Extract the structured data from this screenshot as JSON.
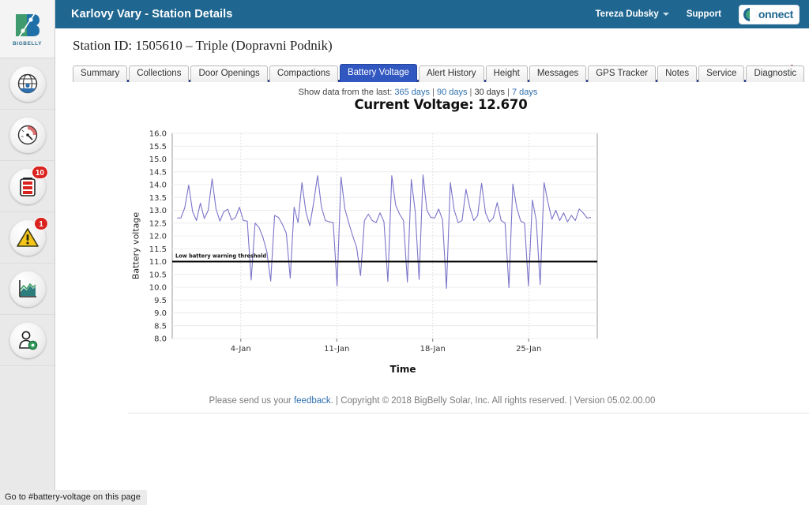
{
  "window": {
    "status_bar_text": "Go to #battery-voltage on this page"
  },
  "rail": {
    "logo": {
      "name": "bigbelly-logo",
      "wordmark": "BIGBELLY"
    },
    "items": [
      {
        "name": "globe-icon",
        "badge": null
      },
      {
        "name": "gauge-icon",
        "badge": null
      },
      {
        "name": "battery-icon",
        "badge": "10"
      },
      {
        "name": "alert-warning-icon",
        "badge": "1"
      },
      {
        "name": "chart-report-icon",
        "badge": null
      },
      {
        "name": "user-settings-icon",
        "badge": null
      }
    ]
  },
  "header": {
    "title": "Karlovy Vary - Station Details",
    "user": "Tereza Dubsky",
    "support": "Support",
    "brand": "onnect",
    "brand_full": "Connect",
    "bg_color": "#1f6690"
  },
  "page": {
    "station_id_label": "Station ID:",
    "station_id_value": "1505610 – Triple (Dopravni Podnik)",
    "station_line": "Station ID: 1505610 – Triple (Dopravni Podnik)",
    "edit_icon": "pencil-icon"
  },
  "tabs": [
    {
      "label": "Summary",
      "active": false
    },
    {
      "label": "Collections",
      "active": false
    },
    {
      "label": "Door Openings",
      "active": false
    },
    {
      "label": "Compactions",
      "active": false
    },
    {
      "label": "Battery Voltage",
      "active": true
    },
    {
      "label": "Alert History",
      "active": false
    },
    {
      "label": "Height",
      "active": false
    },
    {
      "label": "Messages",
      "active": false
    },
    {
      "label": "GPS Tracker",
      "active": false
    },
    {
      "label": "Notes",
      "active": false
    },
    {
      "label": "Service",
      "active": false
    },
    {
      "label": "Diagnostic",
      "active": false
    }
  ],
  "range_selector": {
    "prefix": "Show data from the last:",
    "options": [
      {
        "label": "365 days",
        "selected": false
      },
      {
        "label": "90 days",
        "selected": false
      },
      {
        "label": "30 days",
        "selected": true
      },
      {
        "label": "7 days",
        "selected": false
      }
    ],
    "separator": "|"
  },
  "footer": {
    "prefix": "Please send us your ",
    "link": "feedback",
    "suffix": ". | Copyright © 2018 BigBelly Solar, Inc. All rights reserved. | Version 05.02.00.00"
  },
  "chart_data": {
    "type": "line",
    "title": "Current Voltage: 12.670",
    "current_voltage": "12.670",
    "xlabel": "Time",
    "ylabel": "Battery voltage",
    "ylim": [
      8.0,
      16.0
    ],
    "ytick_step": 0.5,
    "yticks": [
      "16.0",
      "15.5",
      "15.0",
      "14.5",
      "14.0",
      "13.5",
      "13.0",
      "12.5",
      "12.0",
      "11.5",
      "11.0",
      "10.5",
      "10.0",
      "9.5",
      "9.0",
      "8.5",
      "8.0"
    ],
    "xticks": [
      "4-Jan",
      "11-Jan",
      "18-Jan",
      "25-Jan"
    ],
    "xtick_positions": [
      0.1613,
      0.3871,
      0.6129,
      0.8387
    ],
    "grid": true,
    "legend": null,
    "line_color": "#7b74c9",
    "threshold": {
      "label": "Low battery warning threshold",
      "value": 11.0,
      "color": "#000000"
    },
    "series": [
      {
        "name": "Battery voltage",
        "values": [
          12.7,
          12.7,
          13.1,
          13.98,
          12.95,
          12.6,
          13.28,
          12.68,
          13.0,
          14.22,
          13.05,
          12.58,
          12.95,
          13.04,
          12.62,
          12.72,
          13.12,
          12.6,
          12.58,
          10.28,
          12.5,
          12.33,
          11.95,
          11.4,
          10.24,
          12.8,
          12.72,
          12.45,
          12.1,
          10.35,
          13.12,
          12.52,
          14.08,
          12.95,
          12.4,
          13.3,
          14.35,
          13.12,
          12.6,
          12.55,
          12.52,
          10.05,
          14.3,
          13.05,
          12.5,
          12.0,
          11.55,
          10.45,
          12.6,
          12.85,
          12.6,
          12.52,
          12.9,
          12.55,
          10.22,
          14.35,
          13.2,
          12.85,
          12.6,
          10.2,
          14.2,
          12.95,
          10.3,
          14.38,
          13.0,
          12.72,
          12.7,
          13.05,
          12.62,
          9.95,
          14.08,
          13.0,
          12.52,
          12.6,
          13.82,
          13.1,
          12.6,
          12.8,
          14.05,
          12.9,
          12.55,
          12.7,
          13.3,
          12.6,
          12.5,
          9.98,
          14.02,
          13.1,
          12.58,
          12.5,
          10.05,
          13.4,
          12.6,
          10.1,
          14.08,
          13.3,
          12.65,
          13.0,
          12.6,
          12.9,
          12.55,
          12.8,
          12.6,
          13.05,
          12.9,
          12.7,
          12.72
        ]
      }
    ]
  }
}
